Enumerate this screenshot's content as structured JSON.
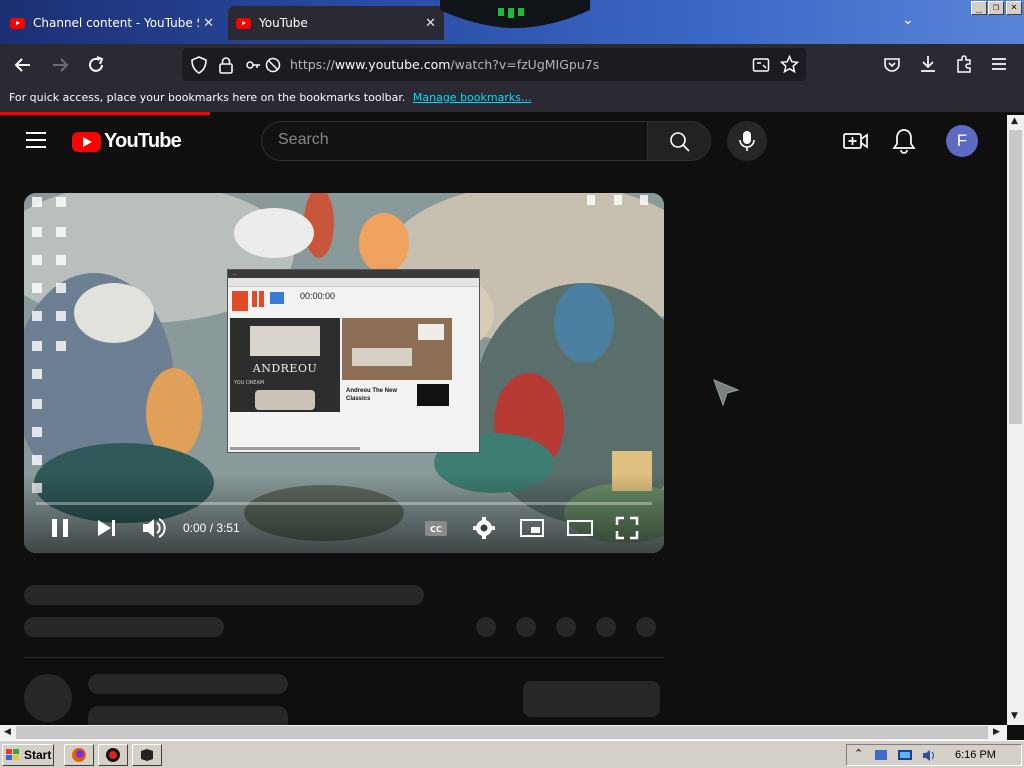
{
  "browser": {
    "tabs": [
      {
        "title": "Channel content - YouTube Studio",
        "active": false
      },
      {
        "title": "YouTube",
        "active": true
      }
    ],
    "url_scheme": "https://",
    "url_host": "www.youtube.com",
    "url_path": "/watch?v=fzUgMIGpu7s",
    "bookmarks_bar": {
      "text": "For quick access, place your bookmarks here on the bookmarks toolbar.",
      "link": "Manage bookmarks..."
    },
    "icons": [
      "back-icon",
      "forward-icon",
      "reload-icon",
      "shield-icon",
      "lock-icon",
      "permissions-icon",
      "reader-view-icon",
      "bookmark-star-icon",
      "pocket-icon",
      "downloads-icon",
      "extensions-icon",
      "menu-icon"
    ]
  },
  "youtube": {
    "logo_text": "YouTube",
    "search_placeholder": "Search",
    "avatar_letter": "F",
    "colors": {
      "brand": "#ff0000",
      "avatar": "#5c6bc0",
      "background": "#0f0f0f"
    }
  },
  "player": {
    "time_display": "0:00 / 3:51",
    "progress": 0.0,
    "state": "playing",
    "inner_window": {
      "title": "...",
      "timer": "00:00:00",
      "ad_brand": "ANDREOU",
      "ad_tagline": "YOU DREAM",
      "ad_caption": "Andreou The New Classics"
    }
  },
  "taskbar": {
    "start_label": "Start",
    "clock": "6:16 PM",
    "apps": [
      "firefox-icon",
      "record-icon",
      "terminal-icon"
    ]
  }
}
